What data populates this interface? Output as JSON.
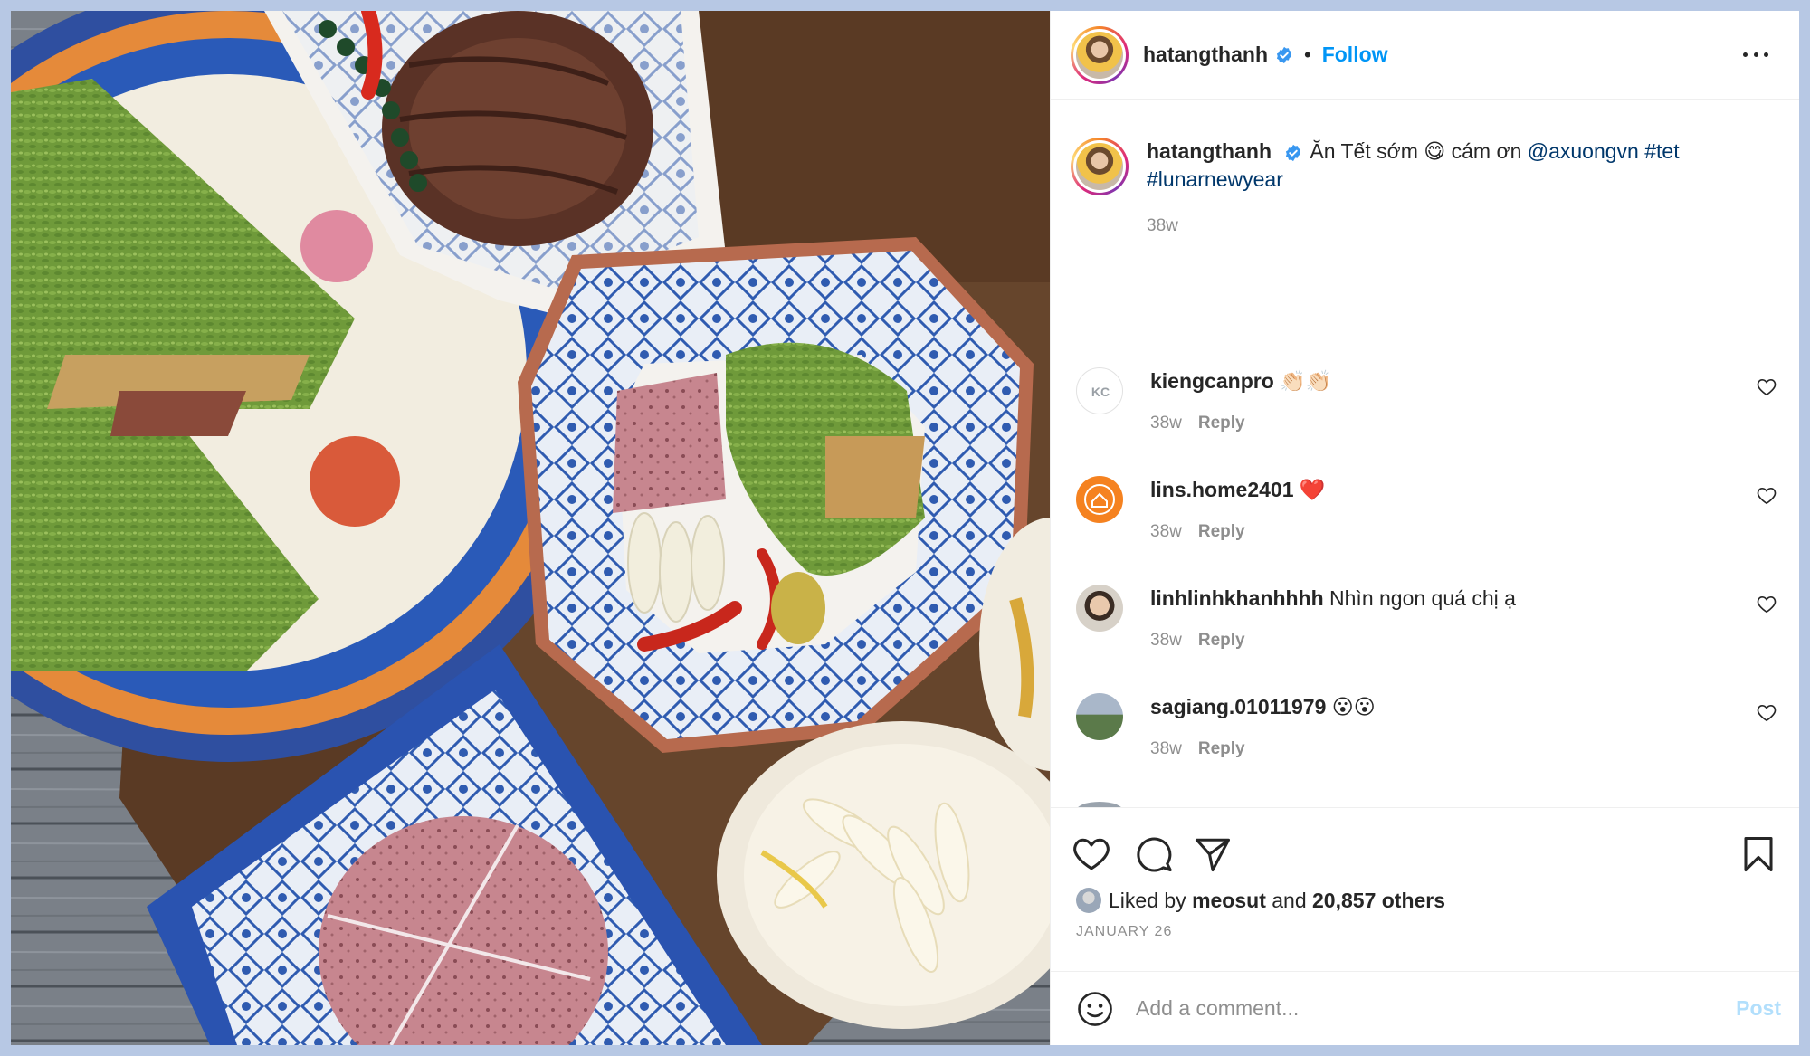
{
  "post": {
    "username": "hatangthanh",
    "follow_label": "Follow",
    "dot": "•"
  },
  "caption": {
    "username": "hatangthanh",
    "text_before": "Ăn Tết sớm ",
    "emoji": "😋",
    "text_mid": " cám ơn ",
    "mention": "@axuongvn",
    "hashtag1": "#tet",
    "hashtag2": "#lunarnewyear",
    "time": "38w"
  },
  "comments": [
    {
      "username": "kiengcanpro",
      "text": "👏🏻👏🏻",
      "time": "38w",
      "reply": "Reply"
    },
    {
      "username": "lins.home2401",
      "text": "❤️",
      "time": "38w",
      "reply": "Reply"
    },
    {
      "username": "linhlinhkhanhhhh",
      "text": "Nhìn ngon quá chị ạ",
      "time": "38w",
      "reply": "Reply"
    },
    {
      "username": "sagiang.01011979",
      "text": "😮😮",
      "time": "38w",
      "reply": "Reply"
    }
  ],
  "likes": {
    "prefix": "Liked by",
    "user": "meosut",
    "conj": "and",
    "others": "20,857 others"
  },
  "date": "JANUARY 26",
  "composer": {
    "placeholder": "Add a comment...",
    "post_label": "Post"
  },
  "colors": {
    "link": "#00376b",
    "follow": "#0095f6",
    "muted": "#8e8e8e",
    "post_disabled": "#b2dffc",
    "background": "#b7c8e4"
  }
}
